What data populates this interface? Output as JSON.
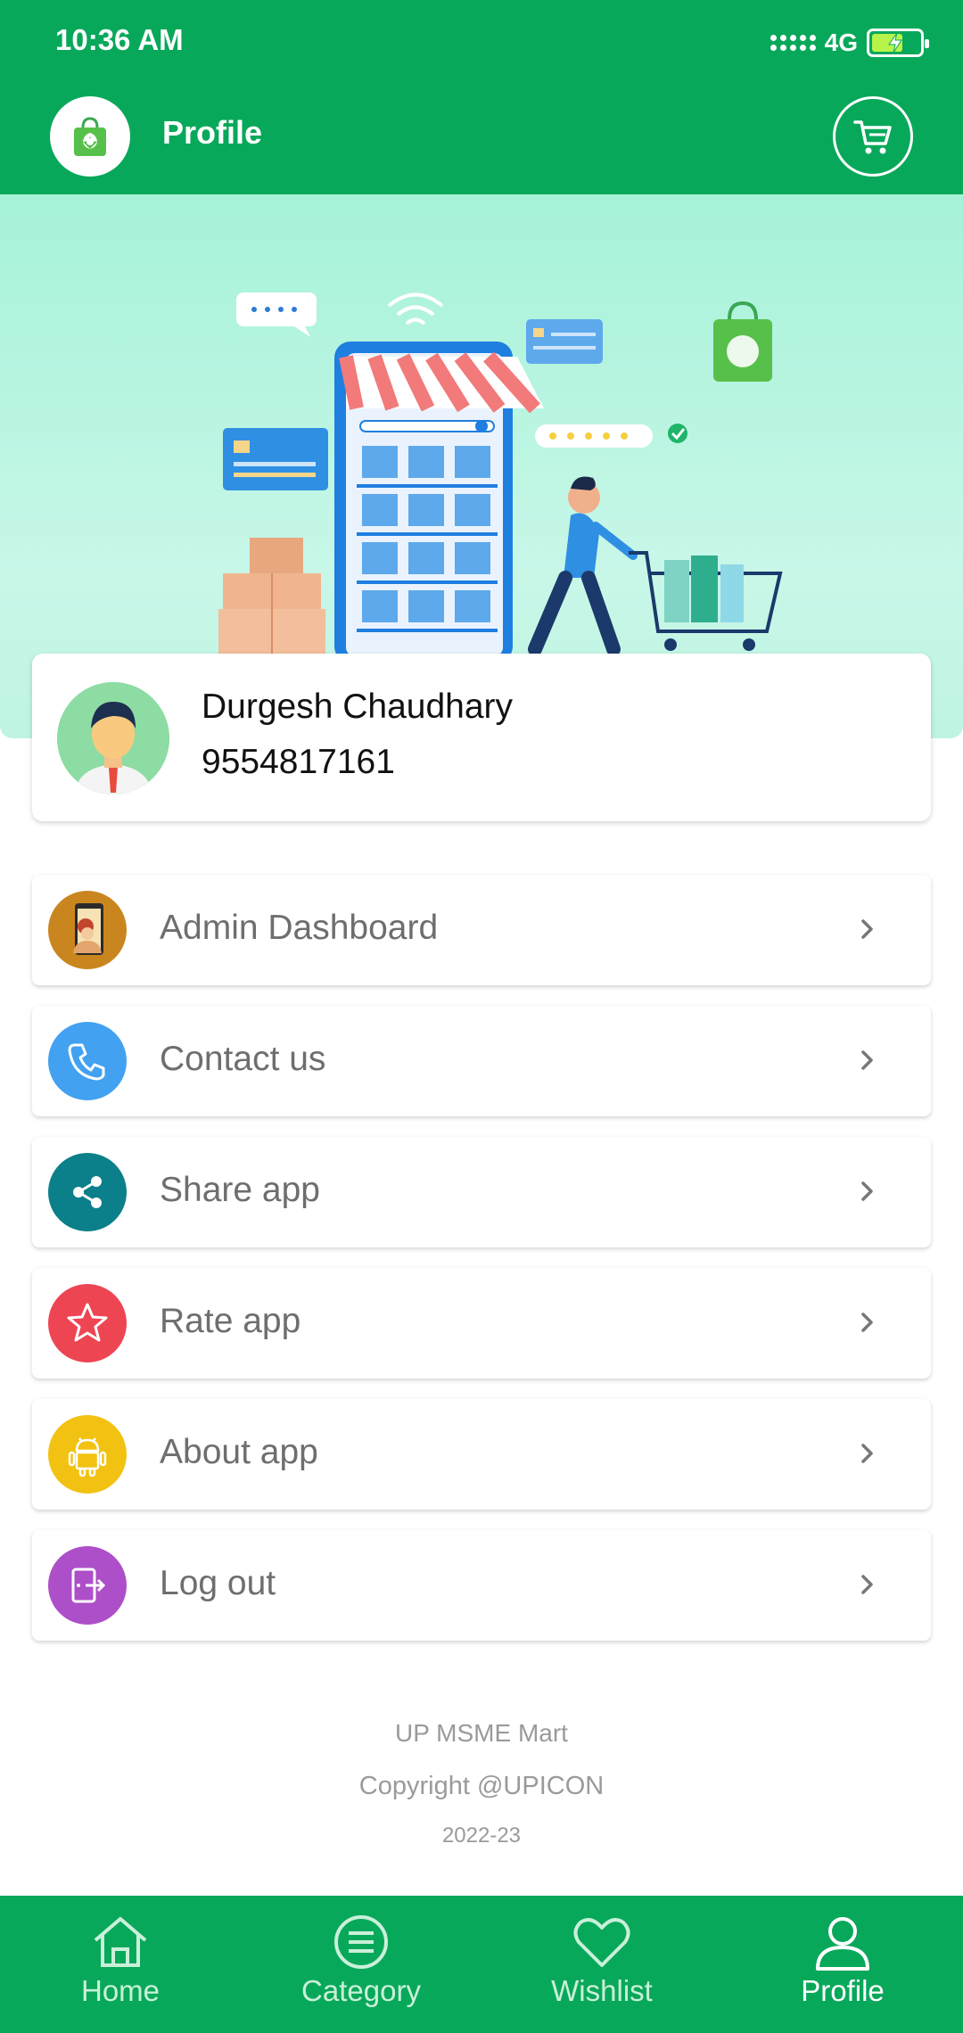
{
  "status_bar": {
    "time": "10:36 AM",
    "network": "4G"
  },
  "app_bar": {
    "title": "Profile"
  },
  "profile": {
    "name": "Durgesh Chaudhary",
    "phone": "9554817161"
  },
  "menu": [
    {
      "label": "Admin Dashboard",
      "icon": "admin-dashboard-icon",
      "color": "#c9861e"
    },
    {
      "label": "Contact us",
      "icon": "phone-icon",
      "color": "#42a1f0"
    },
    {
      "label": "Share app",
      "icon": "share-icon",
      "color": "#0b7f8a"
    },
    {
      "label": "Rate app",
      "icon": "star-icon",
      "color": "#ee4553"
    },
    {
      "label": "About app",
      "icon": "android-icon",
      "color": "#f2c212"
    },
    {
      "label": "Log out",
      "icon": "logout-icon",
      "color": "#ad4fc8"
    }
  ],
  "footer": {
    "app_name": "UP MSME Mart",
    "copyright": "Copyright @UPICON",
    "year": "2022-23"
  },
  "bottom_nav": [
    {
      "label": "Home",
      "icon": "home-icon",
      "active": false
    },
    {
      "label": "Category",
      "icon": "list-icon",
      "active": false
    },
    {
      "label": "Wishlist",
      "icon": "heart-icon",
      "active": false
    },
    {
      "label": "Profile",
      "icon": "user-icon",
      "active": true
    }
  ],
  "colors": {
    "primary": "#08a85a",
    "hero_bg": "#a6f2d9"
  }
}
